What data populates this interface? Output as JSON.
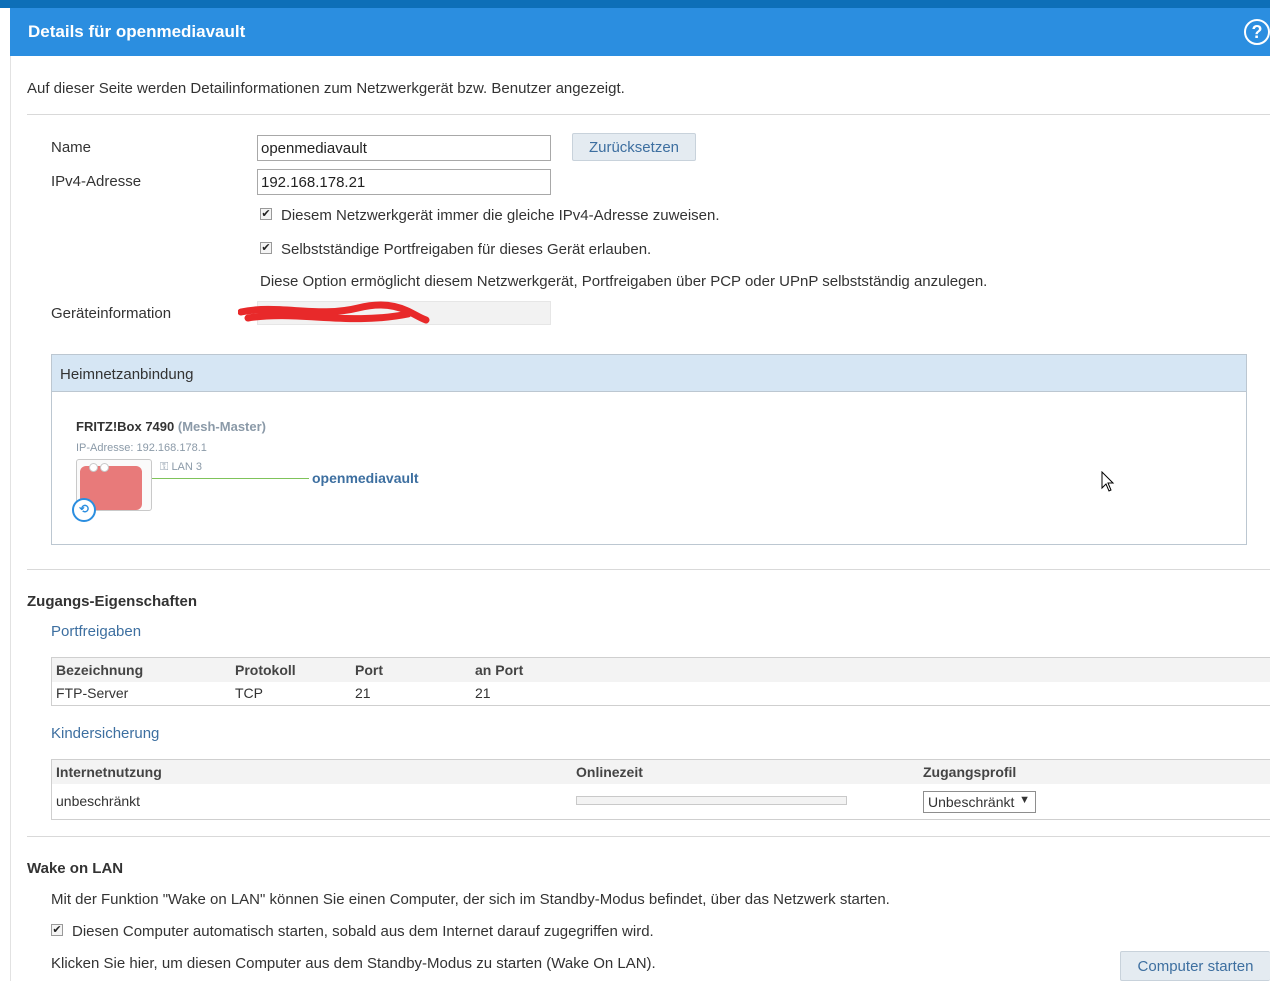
{
  "header": {
    "title": "Details für openmediavault",
    "help_icon": "help-icon"
  },
  "intro": "Auf dieser Seite werden Detailinformationen zum Netzwerkgerät bzw. Benutzer angezeigt.",
  "form": {
    "name_label": "Name",
    "name_value": "openmediavault",
    "reset_button": "Zurücksetzen",
    "ipv4_label": "IPv4-Adresse",
    "ipv4_value": "192.168.178.21",
    "same_ip_checkbox": {
      "checked": true,
      "label": "Diesem Netzwerkgerät immer die gleiche IPv4-Adresse zuweisen."
    },
    "portfw_checkbox": {
      "checked": true,
      "label": "Selbstständige Portfreigaben für dieses Gerät erlauben."
    },
    "option_hint": "Diese Option ermöglicht diesem Netzwerkgerät, Portfreigaben über PCP oder UPnP selbstständig anzulegen.",
    "device_info_label": "Geräteinformation"
  },
  "homenet": {
    "header": "Heimnetzanbindung",
    "router_name": "FRITZ!Box 7490",
    "router_role": "(Mesh-Master)",
    "router_ip": "IP-Adresse: 192.168.178.1",
    "port": "LAN 3",
    "device": "openmediavault",
    "link_color": "#7fc35a"
  },
  "access": {
    "title": "Zugangs-Eigenschaften",
    "portfw_title": "Portfreigaben",
    "portfw_headers": [
      "Bezeichnung",
      "Protokoll",
      "Port",
      "an Port"
    ],
    "portfw_rows": [
      [
        "FTP-Server",
        "TCP",
        "21",
        "21"
      ]
    ],
    "parental_title": "Kindersicherung",
    "parental_headers": [
      "Internetnutzung",
      "Onlinezeit",
      "Zugangsprofil"
    ],
    "parental_row": {
      "usage": "unbeschränkt",
      "online_time_fraction": 0,
      "profile": "Unbeschränkt"
    }
  },
  "wol": {
    "title": "Wake on LAN",
    "description": "Mit der Funktion \"Wake on LAN\" können Sie einen Computer, der sich im Standby-Modus befindet, über das Netzwerk starten.",
    "auto_checkbox": {
      "checked": true,
      "label": "Diesen Computer automatisch starten, sobald aus dem Internet darauf zugegriffen wird."
    },
    "manual_hint": "Klicken Sie hier, um diesen Computer aus dem Standby-Modus zu starten (Wake On LAN).",
    "start_button": "Computer starten"
  },
  "colors": {
    "titlebar": "#2b8ee0",
    "accent": "#3d6fa0",
    "panel_header": "#d6e6f4"
  }
}
